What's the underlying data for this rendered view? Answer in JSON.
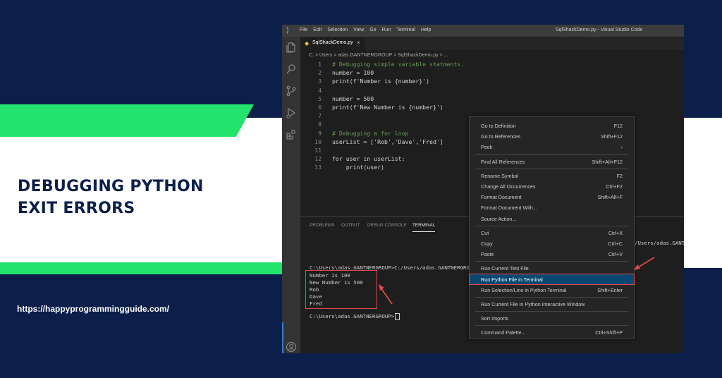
{
  "headline": "DEBUGGING PYTHON\nEXIT ERRORS",
  "site_url": "https://happyprogrammingguide.com/",
  "window": {
    "menu": [
      "File",
      "Edit",
      "Selection",
      "View",
      "Go",
      "Run",
      "Terminal",
      "Help"
    ],
    "title": "SqlShackDemo.py - Visual Studio Code",
    "tab_label": "SqlShackDemo.py",
    "breadcrumb": "C: > Users > adas.GANTNERGROUP > SqlShackDemo.py > ..."
  },
  "editor": {
    "lines": [
      {
        "n": "1",
        "text": "# Debugging simple variable statments.",
        "kind": "comment"
      },
      {
        "n": "2",
        "text": "number = 100",
        "kind": "code"
      },
      {
        "n": "3",
        "text": "print(f'Number is {number}')",
        "kind": "code"
      },
      {
        "n": "4",
        "text": "",
        "kind": "code"
      },
      {
        "n": "5",
        "text": "number = 500",
        "kind": "code"
      },
      {
        "n": "6",
        "text": "print(f'New Number is {number}')",
        "kind": "code"
      },
      {
        "n": "7",
        "text": "",
        "kind": "code"
      },
      {
        "n": "8",
        "text": "",
        "kind": "code"
      },
      {
        "n": "9",
        "text": "# Debugging a for loop",
        "kind": "comment"
      },
      {
        "n": "10",
        "text": "userList = ['Rob','Dave','Fred']",
        "kind": "code"
      },
      {
        "n": "11",
        "text": "",
        "kind": "code"
      },
      {
        "n": "12",
        "text": "for user in userList:",
        "kind": "code"
      },
      {
        "n": "13",
        "text": "    print(user)",
        "kind": "code"
      }
    ]
  },
  "panel": {
    "tabs": [
      "PROBLEMS",
      "OUTPUT",
      "DEBUG CONSOLE",
      "TERMINAL"
    ],
    "active_tab": "TERMINAL",
    "terminal_prompt_line": "C:\\Users\\adas.GANTNERGROUP>C:/Users/adas.GANTNERGROUP",
    "terminal_right_fragment": "/Users/adas.GANT",
    "output": [
      "Number is 100",
      "New Number is 500",
      "Rob",
      "Dave",
      "Fred"
    ],
    "final_prompt": "C:\\Users\\adas.GANTNERGROUP>"
  },
  "context_menu": {
    "groups": [
      [
        {
          "label": "Go to Definition",
          "shortcut": "F12"
        },
        {
          "label": "Go to References",
          "shortcut": "Shift+F12"
        },
        {
          "label": "Peek",
          "shortcut": "›"
        }
      ],
      [
        {
          "label": "Find All References",
          "shortcut": "Shift+Alt+F12"
        }
      ],
      [
        {
          "label": "Rename Symbol",
          "shortcut": "F2"
        },
        {
          "label": "Change All Occurrences",
          "shortcut": "Ctrl+F2"
        },
        {
          "label": "Format Document",
          "shortcut": "Shift+Alt+F"
        },
        {
          "label": "Format Document With...",
          "shortcut": ""
        },
        {
          "label": "Source Action...",
          "shortcut": ""
        }
      ],
      [
        {
          "label": "Cut",
          "shortcut": "Ctrl+X"
        },
        {
          "label": "Copy",
          "shortcut": "Ctrl+C"
        },
        {
          "label": "Paste",
          "shortcut": "Ctrl+V"
        }
      ],
      [
        {
          "label": "Run Current Test File",
          "shortcut": ""
        },
        {
          "label": "Run Python File in Terminal",
          "shortcut": "",
          "highlighted": true
        },
        {
          "label": "Run Selection/Line in Python Terminal",
          "shortcut": "Shift+Enter"
        }
      ],
      [
        {
          "label": "Run Current File in Python Interactive Window",
          "shortcut": ""
        }
      ],
      [
        {
          "label": "Sort Imports",
          "shortcut": ""
        }
      ],
      [
        {
          "label": "Command Palette...",
          "shortcut": "Ctrl+Shift+P"
        }
      ]
    ]
  },
  "colors": {
    "background_navy": "#0b1f4a",
    "accent_green": "#22e36b",
    "annotation_red": "#e04a4a",
    "comment_green": "#6a9955",
    "keyword_purple": "#c586c0",
    "string_orange": "#ce9178"
  },
  "icons": [
    "vscode-logo-icon",
    "explorer-icon",
    "search-icon",
    "source-control-icon",
    "run-debug-icon",
    "extensions-icon",
    "account-icon",
    "python-file-icon",
    "close-icon"
  ]
}
